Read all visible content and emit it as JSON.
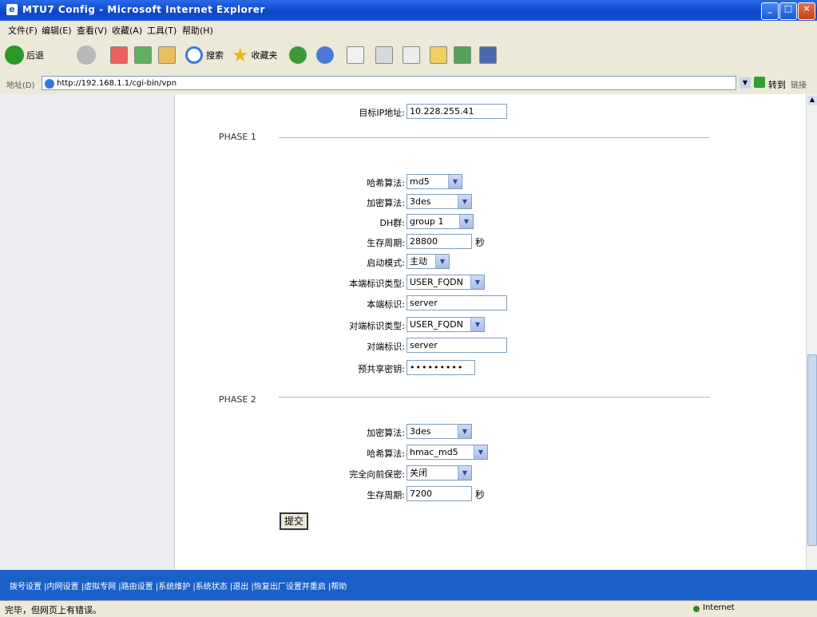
{
  "window": {
    "title": "MTU7 Config - Microsoft Internet Explorer"
  },
  "menu": [
    "文件(F)",
    "编辑(E)",
    "查看(V)",
    "收藏(A)",
    "工具(T)",
    "帮助(H)"
  ],
  "toolbar": {
    "back": "后退",
    "search": "搜索",
    "favorites": "收藏夹"
  },
  "address": {
    "label": "地址(D)",
    "url": "http://192.168.1.1/cgi-bin/vpn",
    "go": "转到",
    "links": "链接"
  },
  "form": {
    "top_field": {
      "label": "目标IP地址:",
      "value": "10.228.255.41"
    },
    "phase1": {
      "title": "PHASE 1",
      "hash": {
        "label": "哈希算法:",
        "value": "md5"
      },
      "encrypt": {
        "label": "加密算法:",
        "value": "3des"
      },
      "dh_group": {
        "label": "DH群:",
        "value": "group 1"
      },
      "lifetime": {
        "label": "生存周期:",
        "value": "28800",
        "unit": "秒"
      },
      "mode": {
        "label": "启动模式:",
        "value": "主动"
      },
      "local_id_type": {
        "label": "本端标识类型:",
        "value": "USER_FQDN"
      },
      "local_id": {
        "label": "本端标识:",
        "value": "server"
      },
      "peer_id_type": {
        "label": "对端标识类型:",
        "value": "USER_FQDN"
      },
      "peer_id": {
        "label": "对端标识:",
        "value": "server"
      },
      "psk": {
        "label": "预共享密钥:",
        "value": "•••••••••"
      }
    },
    "phase2": {
      "title": "PHASE 2",
      "encrypt": {
        "label": "加密算法:",
        "value": "3des"
      },
      "hash": {
        "label": "哈希算法:",
        "value": "hmac_md5"
      },
      "pfs": {
        "label": "完全向前保密:",
        "value": "关闭"
      },
      "lifetime": {
        "label": "生存周期:",
        "value": "7200",
        "unit": "秒"
      }
    },
    "submit": "提交"
  },
  "footer": {
    "links": "拨号设置 |内网设置 |虚拟专网 |路由设置 |系统维护 |系统状态 |退出 |恢复出厂设置并重启 |帮助"
  },
  "status": {
    "message": "完毕，但网页上有错误。",
    "zone": "Internet"
  }
}
